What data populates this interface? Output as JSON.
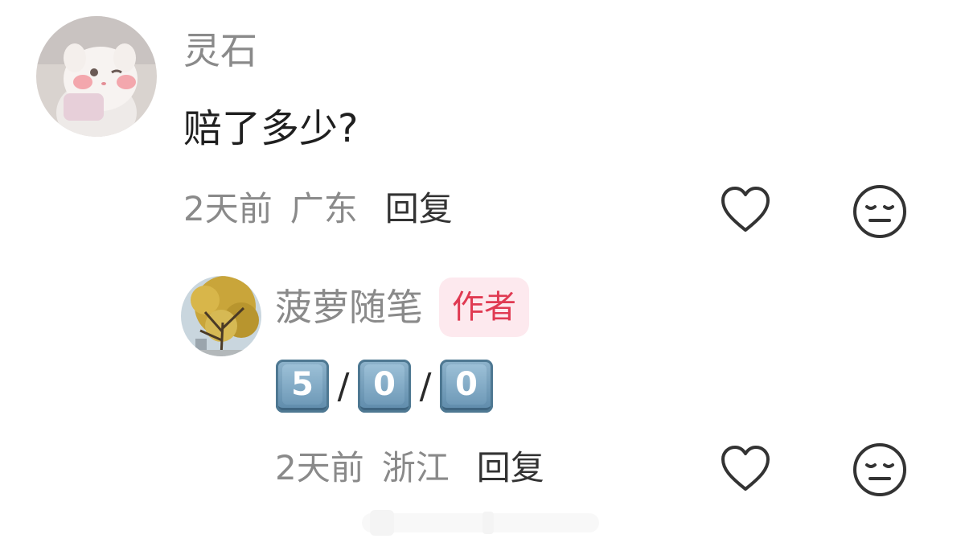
{
  "comments": [
    {
      "username": "灵石",
      "avatar": "avatar-cat",
      "text": "赔了多少?",
      "time": "2天前",
      "location": "广东",
      "reply_label": "回复",
      "like_icon": "heart-outline-icon",
      "dislike_icon": "meh-face-icon"
    }
  ],
  "replies": [
    {
      "username": "菠萝随笔",
      "avatar": "avatar-tree",
      "badge": "作者",
      "keycaps": [
        "5",
        "0",
        "0"
      ],
      "separator": "/",
      "time": "2天前",
      "location": "浙江",
      "reply_label": "回复",
      "like_icon": "heart-outline-icon",
      "dislike_icon": "meh-face-icon"
    }
  ],
  "colors": {
    "muted_text": "#8a8a8a",
    "body_text": "#1f1f1f",
    "badge_bg": "#fde9ee",
    "badge_text": "#e03a52",
    "keycap_blue": "#6f9ab8"
  }
}
